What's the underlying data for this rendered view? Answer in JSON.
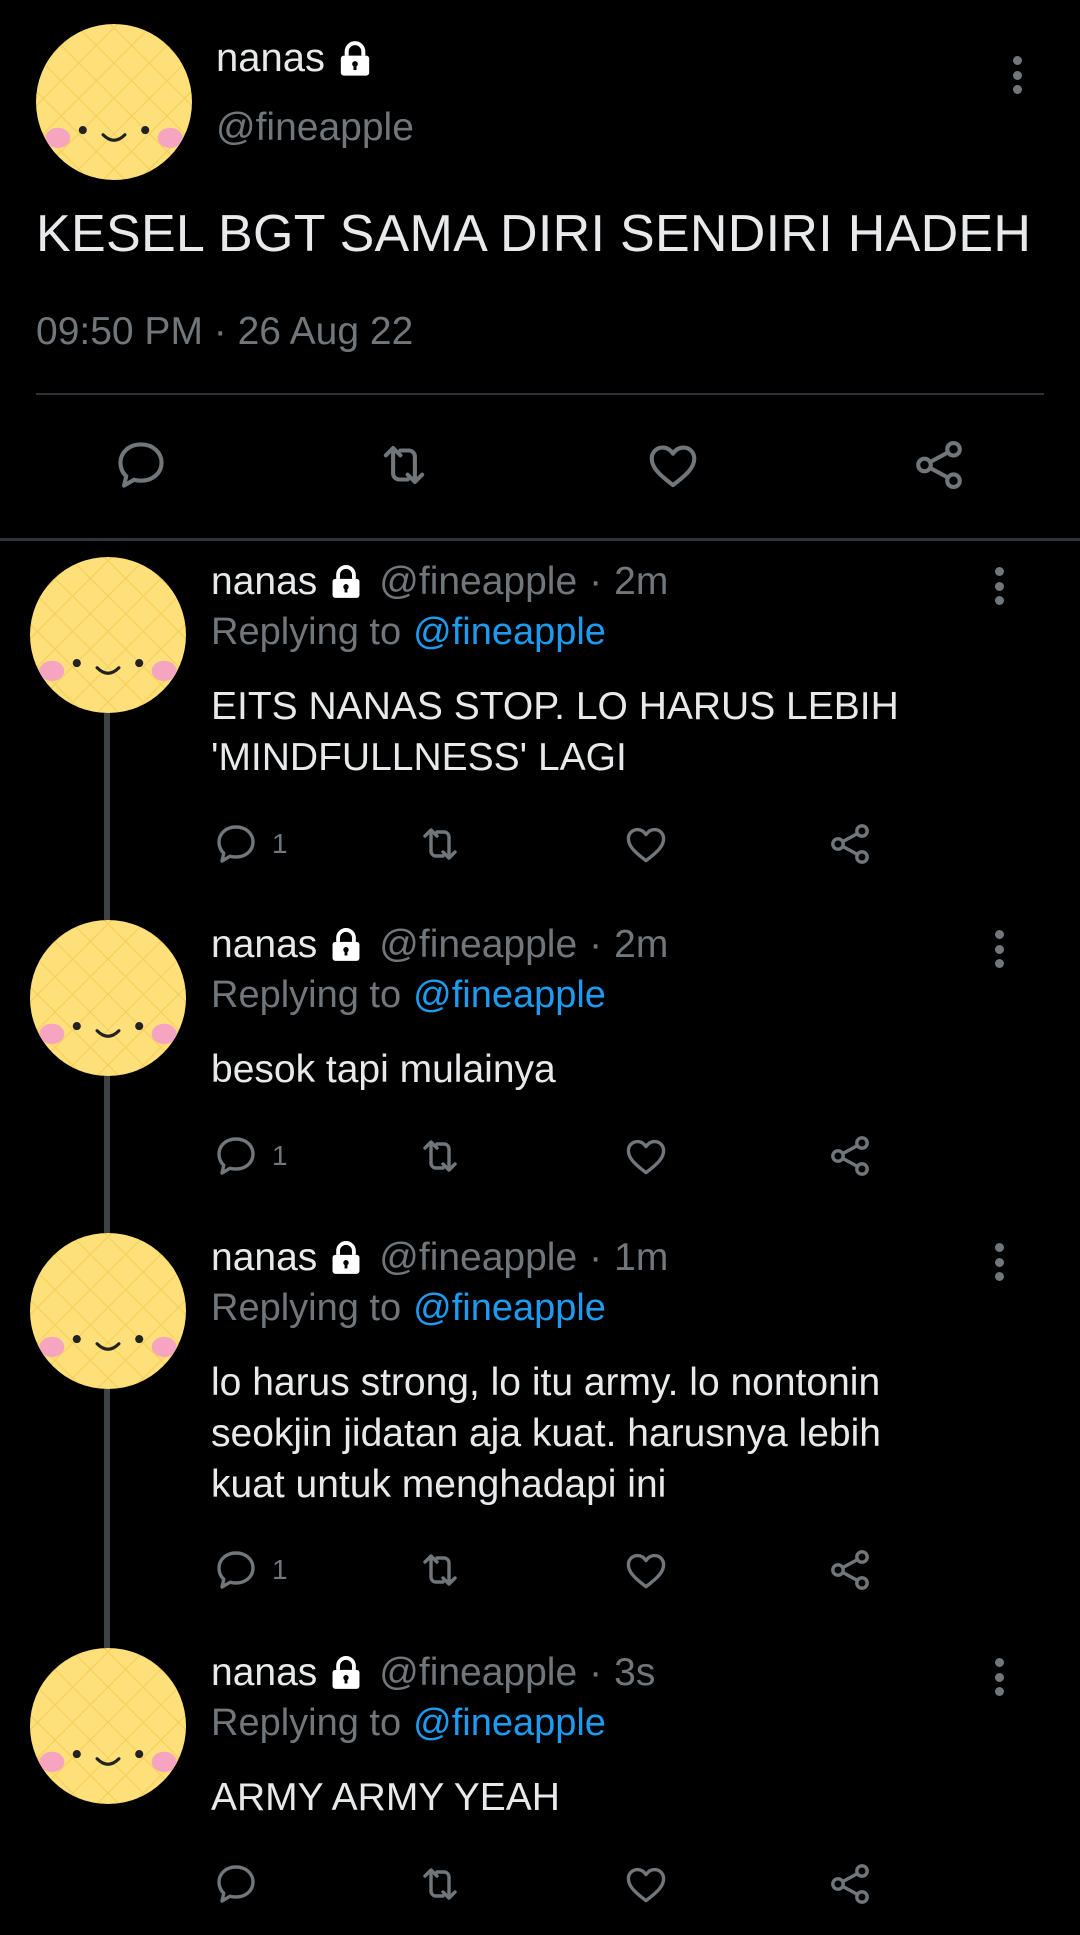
{
  "colors": {
    "background": "#000000",
    "text": "#e7e9ea",
    "muted": "#71767b",
    "link": "#1d9bf0",
    "divider": "#2f3336",
    "avatar_yellow": "#fde07a",
    "avatar_cheek": "#f6a5c0"
  },
  "main_tweet": {
    "name": "nanas",
    "handle": "@fineapple",
    "text": "KESEL BGT SAMA DIRI SENDIRI HADEH",
    "timestamp": "09:50 PM · 26 Aug 22",
    "icons": {
      "more": "more-vertical-icon",
      "reply": "comment-icon",
      "retweet": "retweet-icon",
      "like": "heart-icon",
      "share": "share-icon",
      "lock": "lock-icon"
    }
  },
  "replies": [
    {
      "name": "nanas",
      "handle": "@fineapple",
      "separator": "·",
      "age": "2m",
      "replying_prefix": "Replying to",
      "replying_target": "@fineapple",
      "text_lines": [
        "EITS NANAS STOP. LO HARUS LEBIH",
        "'MINDFULLNESS' LAGI"
      ],
      "reply_count": "1"
    },
    {
      "name": "nanas",
      "handle": "@fineapple",
      "separator": "·",
      "age": "2m",
      "replying_prefix": "Replying to",
      "replying_target": "@fineapple",
      "text_lines": [
        "besok tapi mulainya"
      ],
      "reply_count": "1"
    },
    {
      "name": "nanas",
      "handle": "@fineapple",
      "separator": "·",
      "age": "1m",
      "replying_prefix": "Replying to",
      "replying_target": "@fineapple",
      "text_lines": [
        "lo harus strong, lo itu army. lo nontonin",
        "seokjin jidatan aja kuat. harusnya lebih",
        "kuat untuk menghadapi ini"
      ],
      "reply_count": "1"
    },
    {
      "name": "nanas",
      "handle": "@fineapple",
      "separator": "·",
      "age": "3s",
      "replying_prefix": "Replying to",
      "replying_target": "@fineapple",
      "text_lines": [
        "ARMY ARMY YEAH"
      ],
      "reply_count": ""
    }
  ]
}
